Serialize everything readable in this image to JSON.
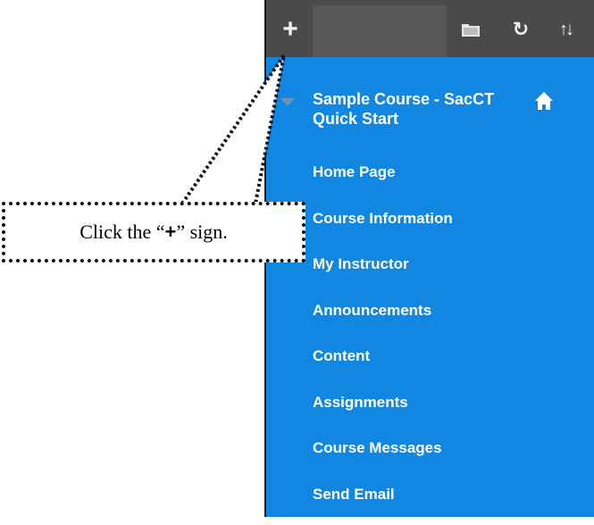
{
  "toolbar": {
    "add_icon": "+",
    "refresh_icon": "↻",
    "sort_icon": "↑↓"
  },
  "course": {
    "title": "Sample Course - SacCT Quick Start"
  },
  "menu": {
    "items": [
      {
        "label": "Home Page"
      },
      {
        "label": "Course Information"
      },
      {
        "label": "My Instructor"
      },
      {
        "label": "Announcements"
      },
      {
        "label": "Content"
      },
      {
        "label": "Assignments"
      },
      {
        "label": "Course Messages"
      },
      {
        "label": "Send Email"
      }
    ]
  },
  "callout": {
    "before": "Click the “",
    "symbol": "+",
    "after": "” sign."
  },
  "colors": {
    "panel_blue": "#1187e2",
    "toolbar_gray": "#4a4a4a",
    "text_white": "#ffffff"
  }
}
